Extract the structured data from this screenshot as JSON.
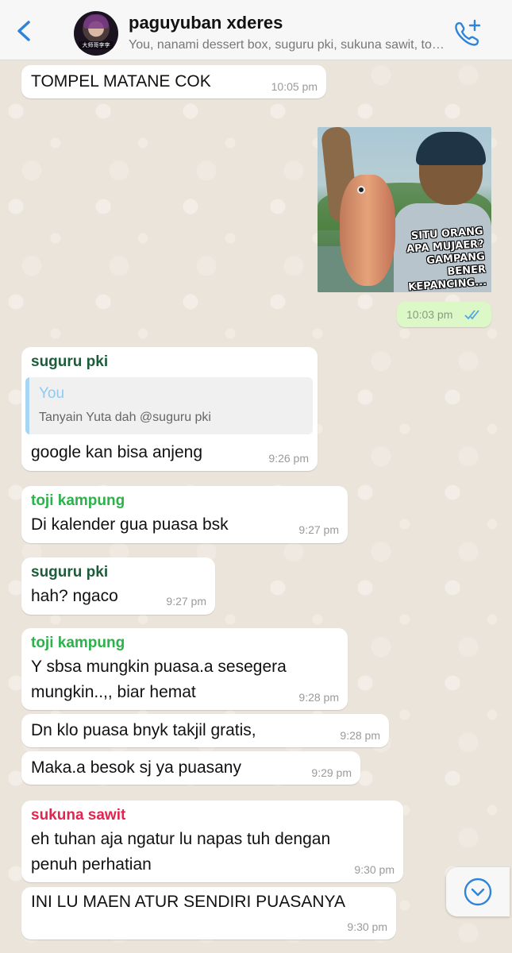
{
  "header": {
    "title": "paguyuban xderes",
    "subtitle": "You, nanami dessert box, suguru pki, sukuna sawit, toji kampung",
    "avatar_label": "大师哥李李"
  },
  "colors": {
    "accent": "#2f84d8",
    "outgoing_bubble": "#dcf8c6",
    "incoming_bubble": "#ffffff",
    "sender_suguru": "#1d5c3b",
    "sender_toji": "#2bb24a",
    "sender_sukuna": "#e0264f"
  },
  "messages": [
    {
      "text": "TOMPEL MATANE COK",
      "time": "10:05 pm"
    },
    {
      "image_caption": "SITU ORANG APA MUJAER? GAMPANG BENER KEPANCING...",
      "time": "10:03 pm",
      "status": "read-double-tick"
    },
    {
      "sender": "suguru pki",
      "quote_author": "You",
      "quote_text": "Tanyain Yuta dah @suguru pki",
      "text": "google kan bisa anjeng",
      "time": "9:26 pm"
    },
    {
      "sender": "toji kampung",
      "text": "Di kalender gua puasa bsk",
      "time": "9:27 pm"
    },
    {
      "sender": "suguru pki",
      "text": "hah? ngaco",
      "time": "9:27 pm"
    },
    {
      "sender": "toji kampung",
      "text_line1": "Y sbsa mungkin puasa.a sesegera",
      "text_line2": "mungkin..,, biar hemat",
      "time": "9:28 pm"
    },
    {
      "text": "Dn klo puasa bnyk takjil gratis,",
      "time": "9:28 pm"
    },
    {
      "text": "Maka.a besok sj ya puasany",
      "time": "9:29 pm"
    },
    {
      "sender": "sukuna sawit",
      "text_line1": "eh tuhan aja ngatur lu napas tuh dengan",
      "text_line2": "penuh perhatian",
      "time": "9:30 pm"
    },
    {
      "text": "INI LU MAEN ATUR SENDIRI PUASANYA",
      "time": "9:30 pm"
    }
  ]
}
